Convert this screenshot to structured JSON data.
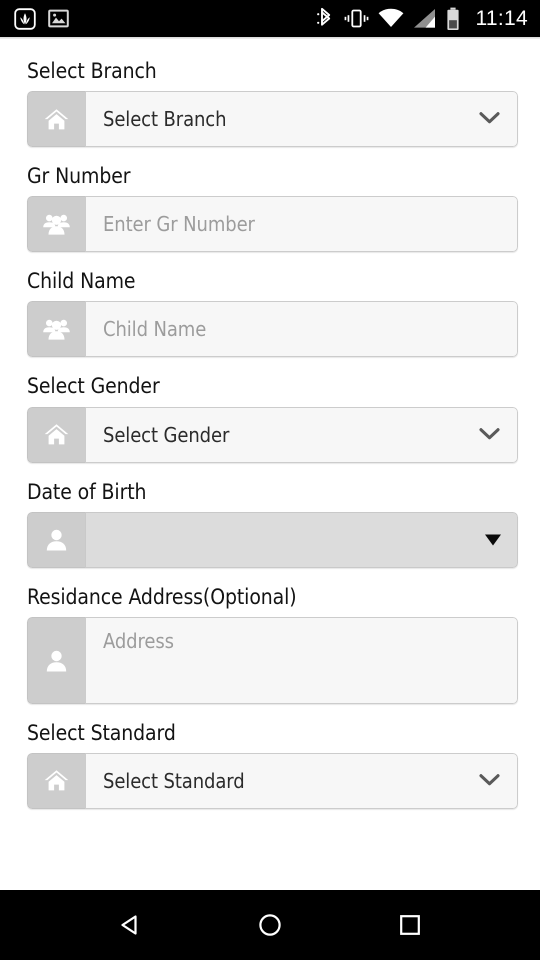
{
  "status_bar": {
    "left_icons": [
      {
        "name": "app-notification-icon",
        "label": "app"
      },
      {
        "name": "photo-notification-icon",
        "label": "image"
      }
    ],
    "right_icons": [
      {
        "name": "bluetooth-icon",
        "label": "Bluetooth"
      },
      {
        "name": "vibrate-icon",
        "label": "Vibrate"
      },
      {
        "name": "wifi-icon",
        "label": "Wi-Fi"
      },
      {
        "name": "cellular-signal-icon",
        "label": "Signal"
      },
      {
        "name": "battery-icon",
        "label": "Battery"
      }
    ],
    "clock": "11:14",
    "background": "#000000",
    "foreground": "#ffffff"
  },
  "form": {
    "fields": [
      {
        "label": "Select Branch",
        "type": "select",
        "icon": "home-icon",
        "value": "Select Branch",
        "value_state": "placeholder"
      },
      {
        "label": "Gr Number",
        "type": "text",
        "icon": "group-icon",
        "placeholder": "Enter Gr Number",
        "value": ""
      },
      {
        "label": "Child Name",
        "type": "text",
        "icon": "group-icon",
        "placeholder": "Child Name",
        "value": ""
      },
      {
        "label": "Select Gender",
        "type": "select",
        "icon": "home-icon",
        "value": "Select Gender",
        "value_state": "placeholder"
      },
      {
        "label": "Date of Birth",
        "type": "spinner",
        "icon": "person-icon",
        "value": "",
        "value_state": "empty"
      },
      {
        "label": "Residance Address(Optional)",
        "type": "textarea",
        "icon": "person-icon",
        "placeholder": "Address",
        "value": ""
      },
      {
        "label": "Select Standard",
        "type": "select",
        "icon": "home-icon",
        "value": "Select Standard",
        "value_state": "placeholder"
      }
    ]
  },
  "nav_bar": {
    "buttons": [
      {
        "name": "back-button",
        "label": "Back"
      },
      {
        "name": "home-button",
        "label": "Home"
      },
      {
        "name": "recents-button",
        "label": "Recents"
      }
    ],
    "background": "#000000"
  },
  "colors": {
    "page_background": "#ffffff",
    "label_text": "#131313",
    "placeholder_text": "#9c9c9c",
    "icon_addon_background": "#cdcdcd",
    "control_background": "#f7f7f7",
    "spinner_background": "#dcdcdc",
    "control_border": "#cccccc"
  }
}
